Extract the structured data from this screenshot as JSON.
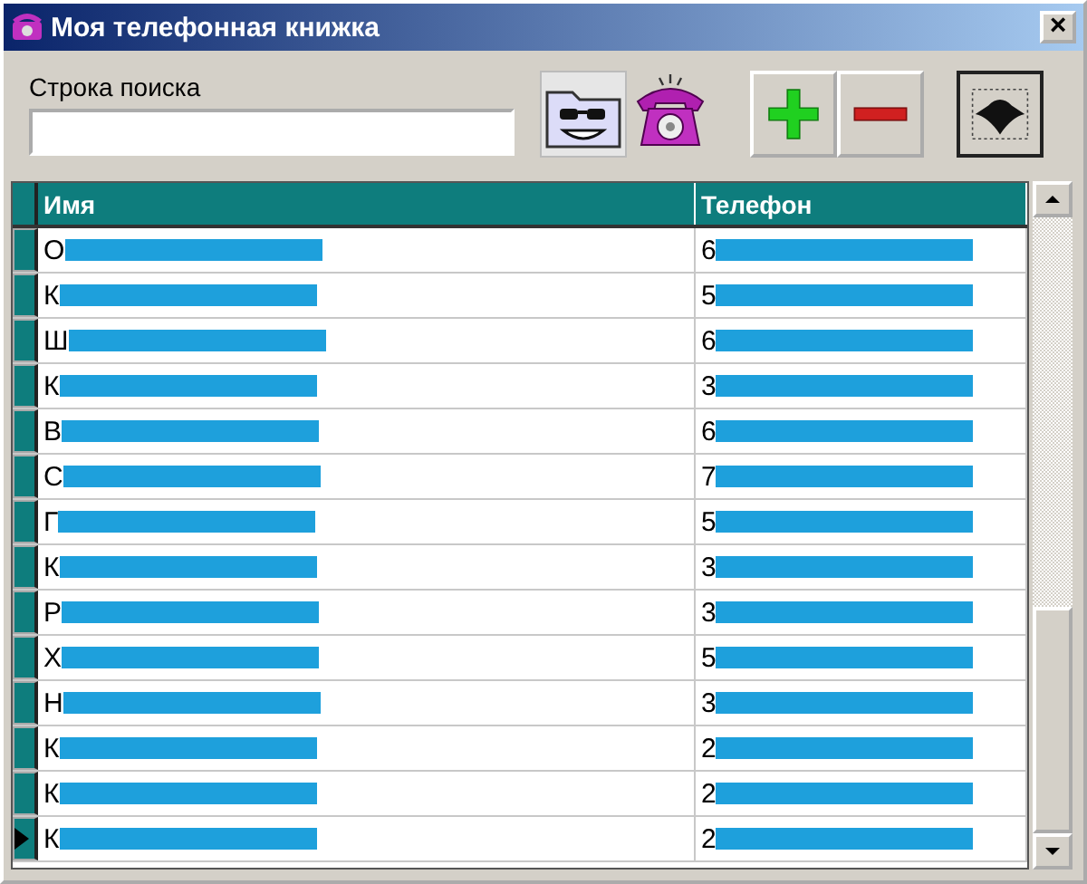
{
  "window": {
    "title": "Моя телефонная книжка",
    "close": "×"
  },
  "search": {
    "label": "Строка поиска"
  },
  "table": {
    "columns": [
      "Имя",
      "Телефон"
    ],
    "rows": [
      {
        "name": "О",
        "phone": "6",
        "selected": false
      },
      {
        "name": "К",
        "phone": "5",
        "selected": false
      },
      {
        "name": "Ш",
        "phone": "6",
        "selected": false
      },
      {
        "name": "К",
        "phone": "3",
        "selected": false
      },
      {
        "name": "В",
        "phone": "6",
        "selected": false
      },
      {
        "name": "С",
        "phone": "7",
        "selected": false
      },
      {
        "name": "Г",
        "phone": "5",
        "selected": false
      },
      {
        "name": "К",
        "phone": "3",
        "selected": false
      },
      {
        "name": "Р",
        "phone": "3",
        "selected": false
      },
      {
        "name": "Х",
        "phone": "5",
        "selected": false
      },
      {
        "name": "Н",
        "phone": "3",
        "selected": false
      },
      {
        "name": "К",
        "phone": "2",
        "selected": false
      },
      {
        "name": "К",
        "phone": "2",
        "selected": false
      },
      {
        "name": "К",
        "phone": "2",
        "selected": true
      }
    ]
  }
}
